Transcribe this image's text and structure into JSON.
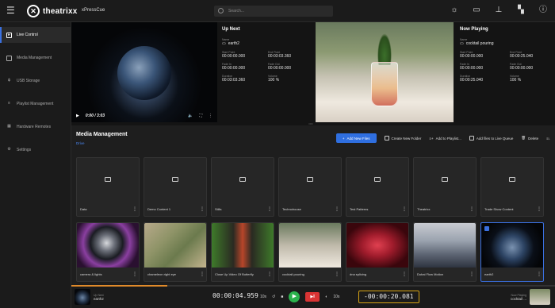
{
  "header": {
    "logo_text": "theatrixx",
    "logo_mark": "✕",
    "product": "xPressCue",
    "search_placeholder": "Search...",
    "icons": [
      "sun-icon",
      "monitor-icon",
      "pin-icon",
      "mapping-icon",
      "info-icon"
    ]
  },
  "sidebar": {
    "items": [
      {
        "label": "Live Control",
        "active": true
      },
      {
        "label": "Media Management"
      },
      {
        "label": "USB Storage"
      },
      {
        "label": "Playlist Management"
      },
      {
        "label": "Hardware Remotes"
      },
      {
        "label": "Settings"
      }
    ]
  },
  "upnext": {
    "title": "Up Next",
    "name_label": "Name",
    "name": "earth2",
    "start_label": "Start Point",
    "start": "00:00:00.000",
    "end_label": "End Point",
    "end": "00:03:03.360",
    "fadein_label": "Fade In",
    "fadein": "00:00:00.000",
    "fadeout_label": "Fade Out",
    "fadeout": "00:00:00.000",
    "duration_label": "Duration",
    "duration": "00:03:03.360",
    "volume_label": "Volume",
    "volume": "100 %",
    "player_time": "0:00 / 3:03"
  },
  "nowplaying": {
    "title": "Now Playing",
    "name_label": "Name",
    "name": "cocktail pouring",
    "start_label": "Start Point",
    "start": "00:00:00.000",
    "end_label": "End Point",
    "end": "00:00:25.040",
    "fadein_label": "Fade In",
    "fadein": "00:00:00.000",
    "fadeout_label": "Fade Out",
    "fadeout": "00:00:00.000",
    "duration_label": "Duration",
    "duration": "00:00:25.040",
    "volume_label": "Volume",
    "volume": "100 %"
  },
  "media": {
    "title": "Media Management",
    "breadcrumb": "Drive",
    "toolbar": {
      "add_files": "Add New Files",
      "new_folder": "Create New Folder",
      "add_playlist": "Add to Playlist...",
      "add_queue": "Add files to Live Queue",
      "delete": "Delete"
    },
    "folders": [
      "Data",
      "Demo Content 1",
      "Stills",
      "Technohouse",
      "Test Patterns",
      "Theatrixx",
      "Trade Show Content"
    ],
    "files": [
      "camera & lights",
      "chameleon right eye",
      "Close Up Video Of Butterfly",
      "cocktail pouring",
      "dna splicing",
      "Dubai Flow Motion",
      "earth2"
    ]
  },
  "transport": {
    "upnext_label": "Up Next",
    "upnext_name": "earth2",
    "elapsed": "00:00:04.959",
    "skip_back": "10s",
    "skip_fwd": "10s",
    "remaining": "-00:00:20.081",
    "nowplaying_label": "Now Playing",
    "nowplaying_name": "cocktail ...",
    "progress_fraction": 0.198
  }
}
